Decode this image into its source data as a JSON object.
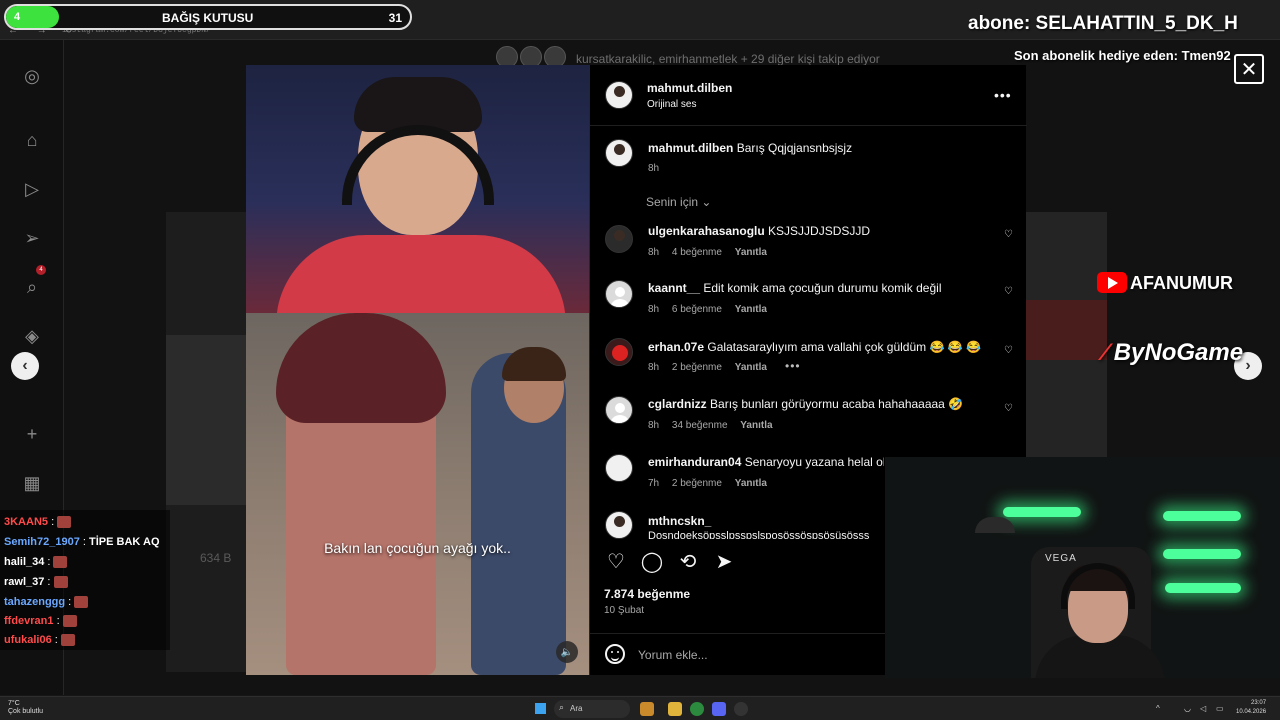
{
  "browser": {
    "url": "instagram.com/reel/DGjeYUCgpDN/"
  },
  "background": {
    "followed_text": "kursatkarakilic, emirhanmetlek + 29 diğer kişi takip ediyor",
    "views": "634 B",
    "sidebar_badge": "4"
  },
  "post": {
    "username": "mahmut.dilben",
    "audio": "Orijinal ses",
    "caption_user": "mahmut.dilben",
    "caption_text": "Barış Qqjqjansnbsjsjz",
    "caption_time": "8h",
    "filter_label": "Senin için",
    "likes": "7.874 beğenme",
    "date": "10 Şubat",
    "comment_placeholder": "Yorum ekle...",
    "video_subtitle": "Bakın lan çocuğun ayağı yok..",
    "comments": [
      {
        "user": "ulgenkarahasanoglu",
        "text": "KSJSJJDJSDSJJD",
        "time": "8h",
        "likes": "4 beğenme",
        "reply": "Yanıtla"
      },
      {
        "user": "kaannt__",
        "text": "Edit komik ama çocuğun durumu komik değil",
        "time": "8h",
        "likes": "6 beğenme",
        "reply": "Yanıtla"
      },
      {
        "user": "erhan.07e",
        "text": "Galatasaraylıyım ama vallahi çok güldüm 😂 😂 😂",
        "time": "8h",
        "likes": "2 beğenme",
        "reply": "Yanıtla"
      },
      {
        "user": "cglardnizz",
        "text": "Barış bunları görüyormu acaba hahahaaaaa 🤣",
        "time": "8h",
        "likes": "34 beğenme",
        "reply": "Yanıtla"
      },
      {
        "user": "emirhanduran04",
        "text": "Senaryoyu yazana helal ols",
        "time": "7h",
        "likes": "2 beğenme",
        "reply": "Yanıtla"
      },
      {
        "user": "mthncskn_",
        "text": "Dosndoeksöpsslpsspslsposöşsöspsösüsöşss",
        "time": "",
        "likes": "",
        "reply": ""
      }
    ]
  },
  "overlay": {
    "donation_left": "4",
    "donation_title": "BAĞIŞ KUTUSU",
    "donation_count": "31",
    "donation_progress": 0.13,
    "sub_ticker": "abone: SELAHATTIN_5_DK_H",
    "gift_text": "Son abonelik hediye eden: Tmen92",
    "youtube_name": "AFANUMUR",
    "sponsor": "ByNoGame",
    "webcam_chair": "VEGA"
  },
  "chat": [
    {
      "name": "3KAAN5",
      "color": "#ff4b4b",
      "msg": ""
    },
    {
      "name": "Semih72_1907",
      "color": "#6aa8ff",
      "msg": "TİPE BAK AQ"
    },
    {
      "name": "halil_34",
      "color": "#ffffff",
      "msg": ""
    },
    {
      "name": "rawl_37",
      "color": "#ffffff",
      "msg": ""
    },
    {
      "name": "tahazenggg",
      "color": "#6aa8ff",
      "msg": ""
    },
    {
      "name": "ffdevran1",
      "color": "#ff4b4b",
      "msg": ""
    },
    {
      "name": "ufukali06",
      "color": "#ff4b4b",
      "msg": ""
    }
  ],
  "taskbar": {
    "weather_temp": "7°C",
    "weather_desc": "Çok bulutlu",
    "search_label": "Ara",
    "time": "23:07",
    "date": "10.04.2026"
  },
  "icons": {
    "close": "close-icon",
    "prev": "chevron-left-icon",
    "next": "chevron-right-icon",
    "more": "more-icon",
    "heart": "heart-icon",
    "comment": "comment-icon",
    "repost": "repost-icon",
    "share": "share-icon"
  },
  "colors": {
    "accent_green": "#3ee23e",
    "youtube_red": "#ff0000",
    "led_green": "#4dff9a"
  }
}
